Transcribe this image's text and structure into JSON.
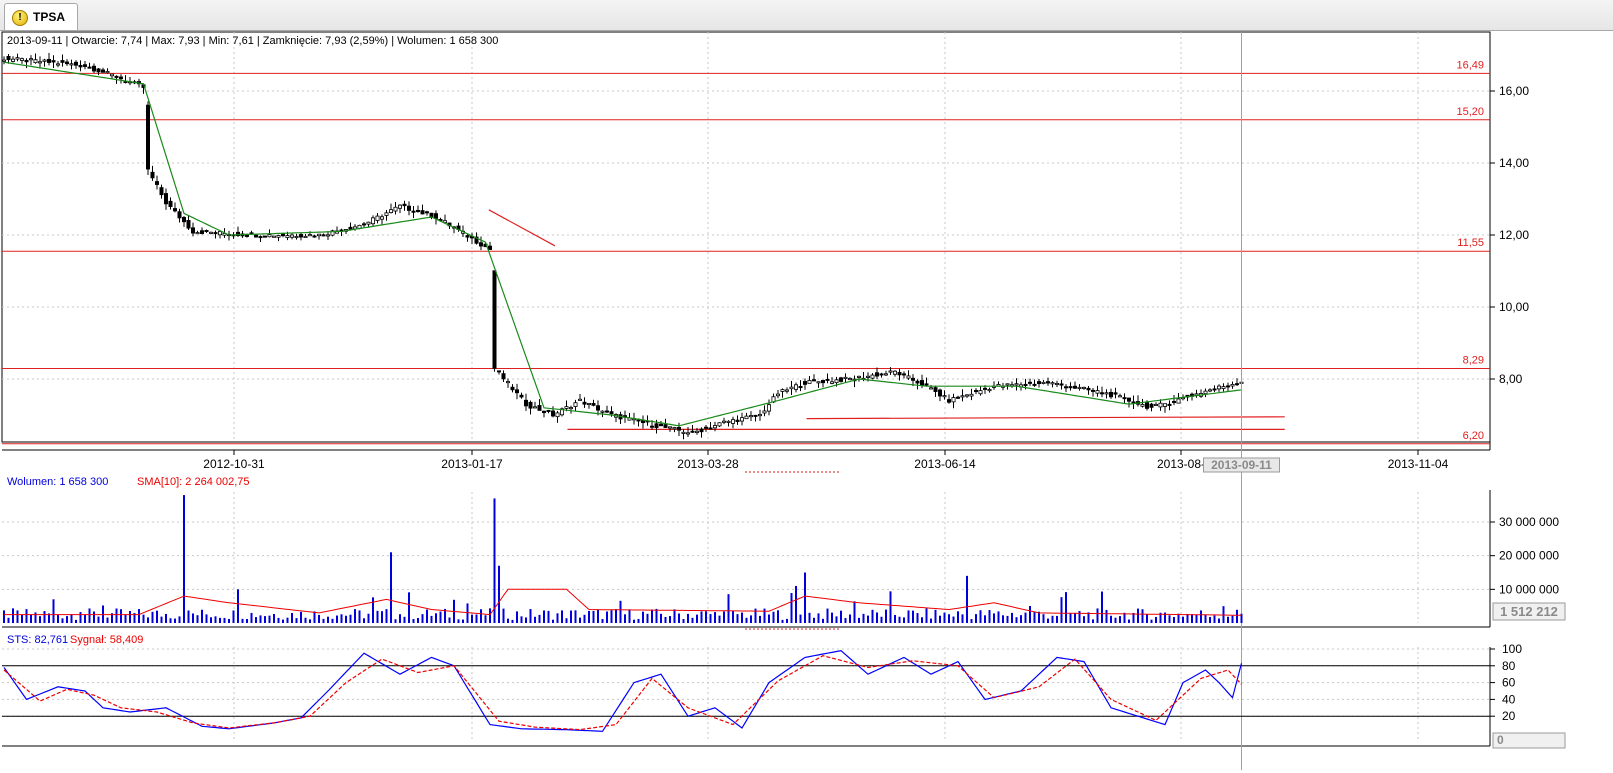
{
  "tab": {
    "label": "TPSA",
    "icon": "warning-exclamation-icon"
  },
  "info_line": "2013-09-11 | Otwarcie: 7,74 | Max: 7,93 | Min: 7,61 | Zamknięcie: 7,93 (2,59%)  | Wolumen: 1 658 300",
  "volume_header": {
    "volume": "Wolumen: 1 658 300",
    "sma": "SMA[10]: 2 264 002,75"
  },
  "sts_header": {
    "sts": "STS: 82,761",
    "signal": "Sygnał: 58,409"
  },
  "cursor_date": "2013-09-11",
  "volume_cursor_value": "1 512 212",
  "sts_cursor_value": "0",
  "colors": {
    "bull": "#ffffff",
    "bear": "#000000",
    "support_lines": "#e02020",
    "ma": "#1a8a1a",
    "volume": "#0000dd",
    "sma": "#ee0000",
    "sts": "#0000ff",
    "signal": "#ee0000"
  },
  "chart_data": [
    {
      "type": "candlestick",
      "title": "",
      "x_ticks": [
        "2012-10-31",
        "2013-01-17",
        "2013-03-28",
        "2013-06-14",
        "2013-08-",
        "2013-11-04"
      ],
      "y_ticks": [
        "8,00",
        "10,00",
        "12,00",
        "14,00",
        "16,00"
      ],
      "ylim": [
        6.0,
        17.2
      ],
      "horizontal_levels": [
        {
          "value": 16.49,
          "label": "16,49"
        },
        {
          "value": 15.2,
          "label": "15,20"
        },
        {
          "value": 11.55,
          "label": "11,55"
        },
        {
          "value": 8.29,
          "label": "8,29"
        },
        {
          "value": 6.2,
          "label": "6,20"
        }
      ],
      "price_path": [
        [
          0,
          16.9
        ],
        [
          10,
          16.8
        ],
        [
          18,
          16.7
        ],
        [
          25,
          16.4
        ],
        [
          31,
          16.1
        ],
        [
          32,
          13.8
        ],
        [
          36,
          12.9
        ],
        [
          42,
          12.1
        ],
        [
          55,
          12.0
        ],
        [
          70,
          12.0
        ],
        [
          80,
          12.3
        ],
        [
          88,
          12.8
        ],
        [
          96,
          12.5
        ],
        [
          108,
          11.6
        ],
        [
          109,
          8.3
        ],
        [
          116,
          7.3
        ],
        [
          122,
          7.0
        ],
        [
          128,
          7.4
        ],
        [
          135,
          7.0
        ],
        [
          145,
          6.7
        ],
        [
          153,
          6.5
        ],
        [
          160,
          6.8
        ],
        [
          168,
          7.0
        ],
        [
          172,
          7.6
        ],
        [
          178,
          7.9
        ],
        [
          188,
          8.0
        ],
        [
          198,
          8.2
        ],
        [
          205,
          7.8
        ],
        [
          210,
          7.4
        ],
        [
          220,
          7.8
        ],
        [
          232,
          7.9
        ],
        [
          245,
          7.6
        ],
        [
          255,
          7.2
        ],
        [
          268,
          7.7
        ],
        [
          275,
          7.93
        ]
      ],
      "ma_path": [
        [
          0,
          16.8
        ],
        [
          31,
          16.2
        ],
        [
          40,
          12.6
        ],
        [
          50,
          12.0
        ],
        [
          75,
          12.1
        ],
        [
          95,
          12.5
        ],
        [
          107,
          11.8
        ],
        [
          120,
          7.2
        ],
        [
          135,
          7.0
        ],
        [
          150,
          6.7
        ],
        [
          172,
          7.4
        ],
        [
          190,
          8.0
        ],
        [
          205,
          7.8
        ],
        [
          225,
          7.8
        ],
        [
          250,
          7.3
        ],
        [
          275,
          7.7
        ]
      ],
      "trend_lines": [
        {
          "from": [
            "2013-01-20",
            12.7
          ],
          "to": [
            "2013-02-10",
            11.7
          ]
        },
        {
          "from": [
            "2013-02-14",
            6.6
          ],
          "to": [
            "2013-09-30",
            6.6
          ]
        },
        {
          "from": [
            "2013-05-01",
            6.9
          ],
          "to": [
            "2013-09-30",
            6.95
          ]
        }
      ],
      "ohlc_last": {
        "date": "2013-09-11",
        "open": 7.74,
        "high": 7.93,
        "low": 7.61,
        "close": 7.93,
        "change_pct": 2.59
      }
    },
    {
      "type": "bar",
      "title": "Wolumen",
      "y_ticks": [
        "10 000 000",
        "20 000 000",
        "30 000 000"
      ],
      "ylim": [
        0,
        38000000
      ],
      "spikes": [
        [
          40,
          38000000
        ],
        [
          52,
          10000000
        ],
        [
          86,
          21000000
        ],
        [
          109,
          37000000
        ],
        [
          110,
          17000000
        ],
        [
          176,
          11000000
        ],
        [
          178,
          15000000
        ],
        [
          214,
          14000000
        ],
        [
          271,
          5000000
        ]
      ],
      "baseline_volume": 2300000,
      "sma_path": [
        [
          0,
          2500000
        ],
        [
          30,
          2500000
        ],
        [
          40,
          8000000
        ],
        [
          50,
          6000000
        ],
        [
          70,
          3000000
        ],
        [
          85,
          7000000
        ],
        [
          95,
          4000000
        ],
        [
          108,
          2500000
        ],
        [
          112,
          10000000
        ],
        [
          125,
          10000000
        ],
        [
          130,
          4000000
        ],
        [
          170,
          3500000
        ],
        [
          178,
          8000000
        ],
        [
          190,
          6000000
        ],
        [
          210,
          4000000
        ],
        [
          220,
          6000000
        ],
        [
          230,
          3000000
        ],
        [
          275,
          2300000
        ]
      ]
    },
    {
      "type": "line",
      "title": "STS",
      "y_ticks": [
        "20",
        "40",
        "60",
        "80",
        "100"
      ],
      "ylim": [
        0,
        100
      ],
      "levels": [
        20,
        80
      ],
      "series": [
        {
          "name": "STS",
          "path": [
            [
              0,
              78
            ],
            [
              5,
              40
            ],
            [
              12,
              55
            ],
            [
              18,
              50
            ],
            [
              22,
              30
            ],
            [
              28,
              25
            ],
            [
              36,
              30
            ],
            [
              44,
              8
            ],
            [
              50,
              5
            ],
            [
              60,
              12
            ],
            [
              66,
              18
            ],
            [
              72,
              50
            ],
            [
              80,
              95
            ],
            [
              88,
              70
            ],
            [
              95,
              90
            ],
            [
              100,
              80
            ],
            [
              108,
              10
            ],
            [
              115,
              5
            ],
            [
              125,
              4
            ],
            [
              133,
              2
            ],
            [
              140,
              60
            ],
            [
              146,
              70
            ],
            [
              152,
              20
            ],
            [
              158,
              30
            ],
            [
              164,
              6
            ],
            [
              170,
              60
            ],
            [
              178,
              90
            ],
            [
              186,
              98
            ],
            [
              192,
              70
            ],
            [
              200,
              90
            ],
            [
              206,
              70
            ],
            [
              212,
              85
            ],
            [
              218,
              40
            ],
            [
              226,
              50
            ],
            [
              234,
              90
            ],
            [
              240,
              85
            ],
            [
              246,
              30
            ],
            [
              252,
              20
            ],
            [
              258,
              10
            ],
            [
              262,
              60
            ],
            [
              267,
              75
            ],
            [
              270,
              60
            ],
            [
              273,
              42
            ],
            [
              275,
              83
            ]
          ]
        },
        {
          "name": "Sygnał",
          "path": [
            [
              0,
              75
            ],
            [
              8,
              38
            ],
            [
              14,
              52
            ],
            [
              20,
              45
            ],
            [
              26,
              30
            ],
            [
              34,
              25
            ],
            [
              42,
              12
            ],
            [
              50,
              6
            ],
            [
              60,
              12
            ],
            [
              68,
              20
            ],
            [
              76,
              60
            ],
            [
              84,
              88
            ],
            [
              92,
              72
            ],
            [
              100,
              80
            ],
            [
              110,
              14
            ],
            [
              118,
              7
            ],
            [
              128,
              4
            ],
            [
              136,
              10
            ],
            [
              144,
              65
            ],
            [
              152,
              30
            ],
            [
              162,
              10
            ],
            [
              172,
              62
            ],
            [
              182,
              92
            ],
            [
              192,
              78
            ],
            [
              202,
              86
            ],
            [
              212,
              80
            ],
            [
              220,
              42
            ],
            [
              230,
              55
            ],
            [
              238,
              88
            ],
            [
              246,
              40
            ],
            [
              256,
              15
            ],
            [
              266,
              65
            ],
            [
              272,
              75
            ],
            [
              275,
              58
            ]
          ]
        }
      ]
    }
  ]
}
